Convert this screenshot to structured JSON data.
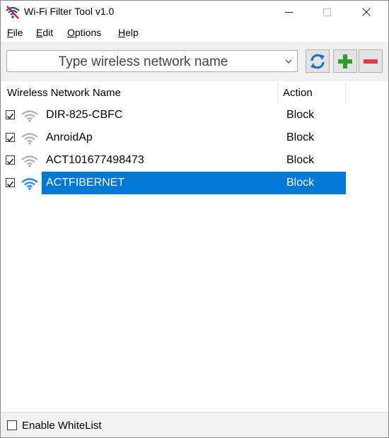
{
  "window": {
    "title": "Wi-Fi Filter Tool v1.0"
  },
  "menu": [
    {
      "label": "File",
      "accel": "F",
      "rest": "ile"
    },
    {
      "label": "Edit",
      "accel": "E",
      "rest": "dit"
    },
    {
      "label": "Options",
      "accel": "O",
      "rest": "ptions"
    },
    {
      "label": "Help",
      "accel": "H",
      "rest": "elp"
    }
  ],
  "toolbar": {
    "network_combo_placeholder": "Type wireless network name",
    "refresh_icon": "refresh-icon",
    "add_icon": "plus-icon",
    "remove_icon": "minus-icon"
  },
  "list": {
    "columns": {
      "name": "Wireless Network Name",
      "action": "Action"
    },
    "rows": [
      {
        "checked": true,
        "name": "DIR-825-CBFC",
        "action": "Block",
        "selected": false
      },
      {
        "checked": true,
        "name": "AnroidAp",
        "action": "Block",
        "selected": false
      },
      {
        "checked": true,
        "name": "ACT101677498473",
        "action": "Block",
        "selected": false
      },
      {
        "checked": true,
        "name": "ACTFIBERNET",
        "action": "Block",
        "selected": true
      }
    ]
  },
  "status": {
    "whitelist_label": "Enable WhiteList",
    "whitelist_checked": false
  },
  "colors": {
    "selection": "#0078d7",
    "wifi_inactive": "#b4b4b4",
    "wifi_active": "#1e90ff",
    "add": "#2e9e2e",
    "remove": "#e0394c"
  }
}
